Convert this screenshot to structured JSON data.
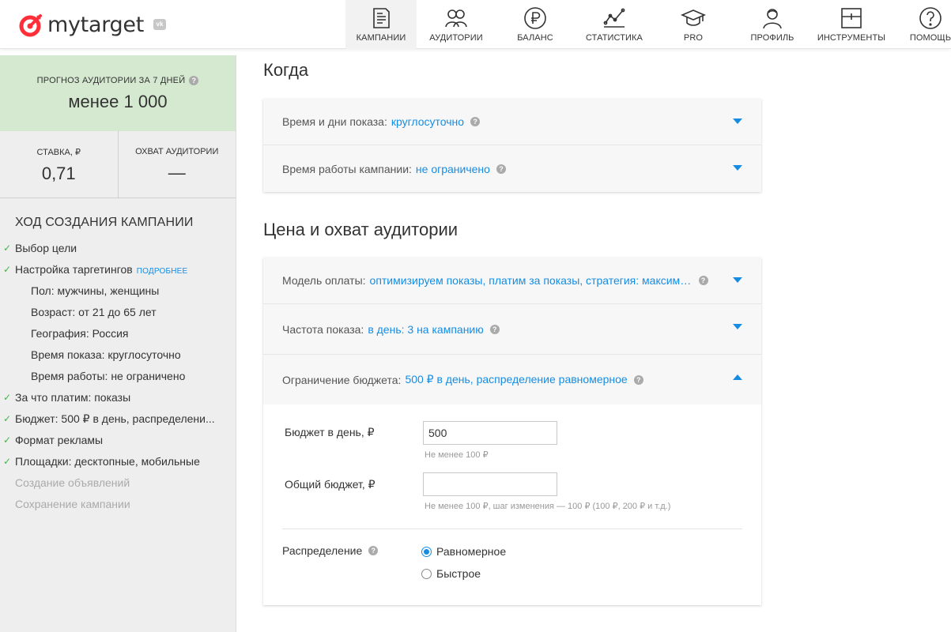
{
  "brand": {
    "name": "mytarget",
    "vk_badge": "vk",
    "accent": "#ff2f3a"
  },
  "nav": [
    {
      "label": "КАМПАНИИ",
      "icon": "campaigns-icon",
      "active": true
    },
    {
      "label": "АУДИТОРИИ",
      "icon": "audiences-icon"
    },
    {
      "label": "БАЛАНС",
      "icon": "ruble-icon"
    },
    {
      "label": "СТАТИСТИКА",
      "icon": "statistics-icon"
    },
    {
      "label": "PRO",
      "icon": "graduation-cap-icon"
    },
    {
      "label": "ПРОФИЛЬ",
      "icon": "profile-icon"
    },
    {
      "label": "ИНСТРУМЕНТЫ",
      "icon": "tools-icon"
    },
    {
      "label": "ПОМОЩЬ",
      "icon": "help-icon"
    }
  ],
  "sidebar": {
    "forecast_title": "ПРОГНОЗ АУДИТОРИИ ЗА 7 ДНЕЙ",
    "forecast_value": "менее 1 000",
    "rate_label": "СТАВКА, ₽",
    "rate_value": "0,71",
    "reach_label": "ОХВАТ АУДИТОРИИ",
    "reach_value": "—",
    "progress_title": "ХОД СОЗДАНИЯ КАМПАНИИ",
    "more_link": "ПОДРОБНЕЕ",
    "steps": [
      {
        "text": "Выбор цели",
        "state": "done"
      },
      {
        "text": "Настройка таргетингов",
        "state": "done",
        "more": true
      },
      {
        "text": "Пол: мужчины, женщины",
        "state": "sub"
      },
      {
        "text": "Возраст: от 21 до 65 лет",
        "state": "sub"
      },
      {
        "text": "География: Россия",
        "state": "sub"
      },
      {
        "text": "Время показа: круглосуточно",
        "state": "sub"
      },
      {
        "text": "Время работы: не ограничено",
        "state": "sub"
      },
      {
        "text": "За что платим: показы",
        "state": "done"
      },
      {
        "text": "Бюджет: 500 ₽ в день, распределени...",
        "state": "done"
      },
      {
        "text": "Формат рекламы",
        "state": "done"
      },
      {
        "text": "Площадки: десктопные, мобильные",
        "state": "done"
      },
      {
        "text": "Создание объявлений",
        "state": "todo"
      },
      {
        "text": "Сохранение кампании",
        "state": "todo"
      }
    ]
  },
  "when": {
    "title": "Когда",
    "show_time_label": "Время и дни показа:",
    "show_time_value": "круглосуточно",
    "work_time_label": "Время работы кампании:",
    "work_time_value": "не ограничено"
  },
  "price": {
    "title": "Цена и охват аудитории",
    "payment_label": "Модель оплаты:",
    "payment_value": "оптимизируем показы, платим за показы, стратегия: максимальное число показов",
    "frequency_label": "Частота показа:",
    "frequency_value": "в день: 3 на кампанию",
    "budget_label": "Ограничение бюджета:",
    "budget_value": "500 ₽ в день, распределение равномерное"
  },
  "budget_form": {
    "daily_label": "Бюджет в день, ₽",
    "daily_value": "500",
    "daily_hint": "Не менее 100 ₽",
    "total_label": "Общий бюджет, ₽",
    "total_value": "",
    "total_hint": "Не менее 100 ₽, шаг изменения — 100 ₽ (100 ₽, 200 ₽ и т.д.)",
    "distribution_label": "Распределение",
    "options": [
      "Равномерное",
      "Быстрое"
    ],
    "selected": "Равномерное"
  }
}
